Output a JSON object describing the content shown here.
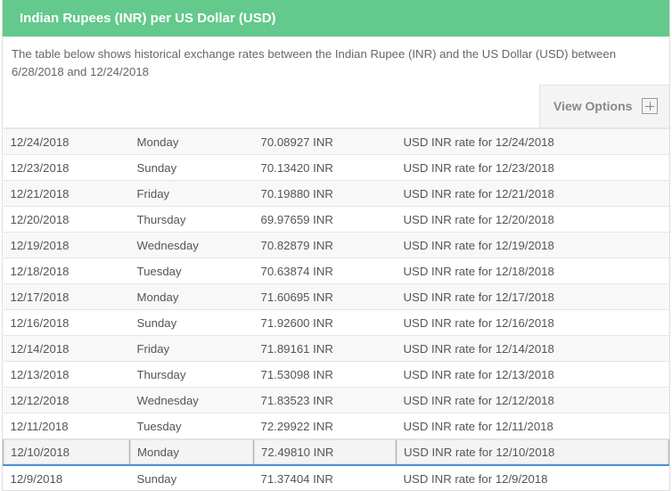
{
  "header": {
    "title": "Indian Rupees (INR) per US Dollar (USD)"
  },
  "description": "The table below shows historical exchange rates between the Indian Rupee (INR) and the US Dollar (USD) between 6/28/2018 and 12/24/2018",
  "view_options": {
    "label": "View Options",
    "icon": "plus-icon"
  },
  "colors": {
    "header_bg": "#63c98d",
    "selected_border": "#b8b8b8",
    "focus_line": "#4a90d9"
  },
  "rows": [
    {
      "date": "12/24/2018",
      "day": "Monday",
      "rate": "70.08927 INR",
      "link": "USD INR rate for 12/24/2018"
    },
    {
      "date": "12/23/2018",
      "day": "Sunday",
      "rate": "70.13420 INR",
      "link": "USD INR rate for 12/23/2018"
    },
    {
      "date": "12/21/2018",
      "day": "Friday",
      "rate": "70.19880 INR",
      "link": "USD INR rate for 12/21/2018"
    },
    {
      "date": "12/20/2018",
      "day": "Thursday",
      "rate": "69.97659 INR",
      "link": "USD INR rate for 12/20/2018"
    },
    {
      "date": "12/19/2018",
      "day": "Wednesday",
      "rate": "70.82879 INR",
      "link": "USD INR rate for 12/19/2018"
    },
    {
      "date": "12/18/2018",
      "day": "Tuesday",
      "rate": "70.63874 INR",
      "link": "USD INR rate for 12/18/2018"
    },
    {
      "date": "12/17/2018",
      "day": "Monday",
      "rate": "71.60695 INR",
      "link": "USD INR rate for 12/17/2018"
    },
    {
      "date": "12/16/2018",
      "day": "Sunday",
      "rate": "71.92600 INR",
      "link": "USD INR rate for 12/16/2018"
    },
    {
      "date": "12/14/2018",
      "day": "Friday",
      "rate": "71.89161 INR",
      "link": "USD INR rate for 12/14/2018"
    },
    {
      "date": "12/13/2018",
      "day": "Thursday",
      "rate": "71.53098 INR",
      "link": "USD INR rate for 12/13/2018"
    },
    {
      "date": "12/12/2018",
      "day": "Wednesday",
      "rate": "71.83523 INR",
      "link": "USD INR rate for 12/12/2018"
    },
    {
      "date": "12/11/2018",
      "day": "Tuesday",
      "rate": "72.29922 INR",
      "link": "USD INR rate for 12/11/2018"
    },
    {
      "date": "12/10/2018",
      "day": "Monday",
      "rate": "72.49810 INR",
      "link": "USD INR rate for 12/10/2018"
    },
    {
      "date": "12/9/2018",
      "day": "Sunday",
      "rate": "71.37404 INR",
      "link": "USD INR rate for 12/9/2018"
    }
  ]
}
